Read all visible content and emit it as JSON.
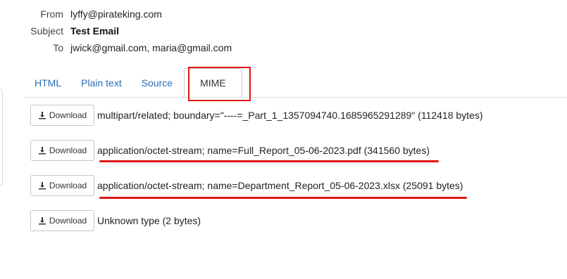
{
  "headers": {
    "from_label": "From",
    "from_value": "lyffy@pirateking.com",
    "subject_label": "Subject",
    "subject_value": "Test Email",
    "to_label": "To",
    "to_value": "jwick@gmail.com, maria@gmail.com"
  },
  "tabs": [
    {
      "label": "HTML"
    },
    {
      "label": "Plain text"
    },
    {
      "label": "Source"
    },
    {
      "label": "MIME",
      "active": true
    }
  ],
  "parts": [
    {
      "button": "Download",
      "text": "multipart/related; boundary=\"----=_Part_1_1357094740.1685965291289\" (112418 bytes)"
    },
    {
      "button": "Download",
      "text": "application/octet-stream; name=Full_Report_05-06-2023.pdf (341560 bytes)"
    },
    {
      "button": "Download",
      "text": "application/octet-stream; name=Department_Report_05-06-2023.xlsx (25091 bytes)"
    },
    {
      "button": "Download",
      "text": "Unknown type (2 bytes)"
    }
  ],
  "icons": {
    "download": "download-icon"
  },
  "colors": {
    "link": "#2a6db5",
    "annotation": "#e01515"
  }
}
